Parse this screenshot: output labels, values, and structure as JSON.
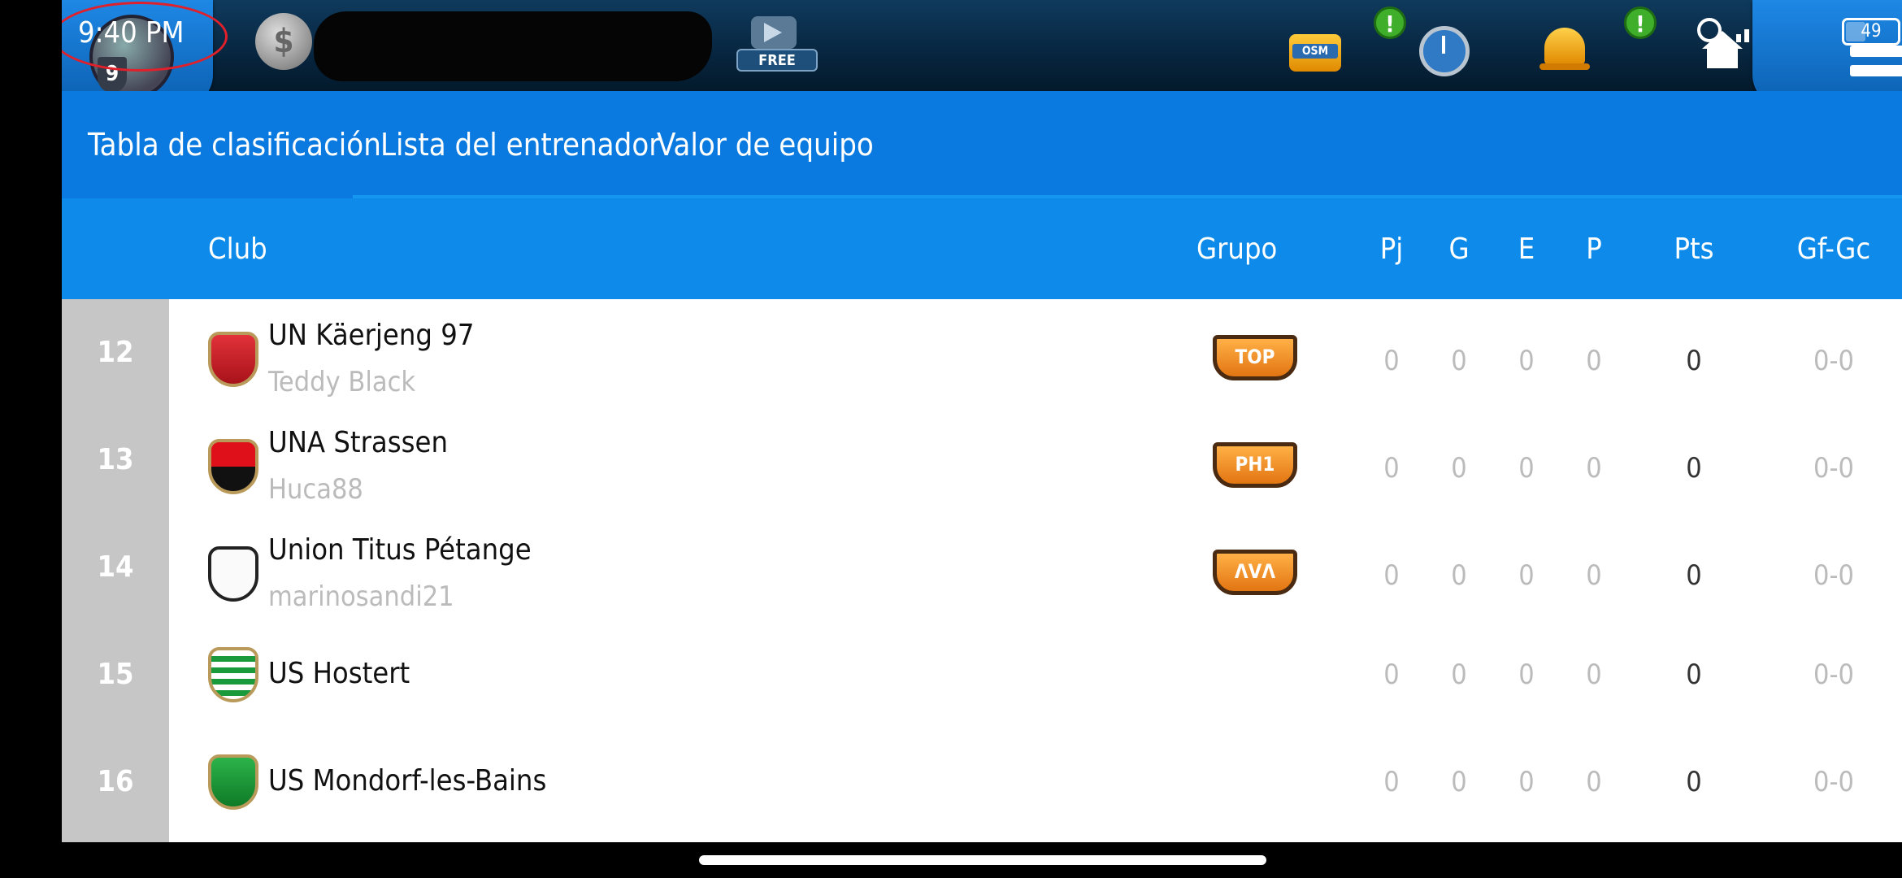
{
  "status_bar": {
    "time": "9:40 PM",
    "battery": "49"
  },
  "top_bar": {
    "coin_symbol": "$",
    "level": "9",
    "free_label": "FREE",
    "osm_label": "OSM",
    "alert_mark": "!"
  },
  "tabs": [
    {
      "label": "Tabla de clasificación",
      "active": true
    },
    {
      "label": "Lista del entrenador",
      "active": false
    },
    {
      "label": "Valor de equipo",
      "active": false
    }
  ],
  "columns": {
    "club": "Club",
    "group": "Grupo",
    "pj": "Pj",
    "g": "G",
    "e": "E",
    "p": "P",
    "pts": "Pts",
    "gf_gc": "Gf-Gc"
  },
  "rows": [
    {
      "rank": "12",
      "club": "UN Käerjeng 97",
      "coach": "Teddy Black",
      "badge": "TOP",
      "pj": "0",
      "g": "0",
      "e": "0",
      "p": "0",
      "pts": "0",
      "gf_gc": "0-0"
    },
    {
      "rank": "13",
      "club": "UNA Strassen",
      "coach": "Huca88",
      "badge": "PH1",
      "pj": "0",
      "g": "0",
      "e": "0",
      "p": "0",
      "pts": "0",
      "gf_gc": "0-0"
    },
    {
      "rank": "14",
      "club": "Union Titus Pétange",
      "coach": "marinosandi21",
      "badge": "ΛVΛ",
      "pj": "0",
      "g": "0",
      "e": "0",
      "p": "0",
      "pts": "0",
      "gf_gc": "0-0"
    },
    {
      "rank": "15",
      "club": "US Hostert",
      "coach": "",
      "badge": "",
      "pj": "0",
      "g": "0",
      "e": "0",
      "p": "0",
      "pts": "0",
      "gf_gc": "0-0"
    },
    {
      "rank": "16",
      "club": "US Mondorf-les-Bains",
      "coach": "",
      "badge": "",
      "pj": "0",
      "g": "0",
      "e": "0",
      "p": "0",
      "pts": "0",
      "gf_gc": "0-0"
    }
  ],
  "colors": {
    "tab_bar": "#0a7ae0",
    "header_row": "#0d8aea",
    "rank_column": "#c6c6c6",
    "badge": "#f08a1e",
    "clock_highlight": "#e0202a"
  }
}
